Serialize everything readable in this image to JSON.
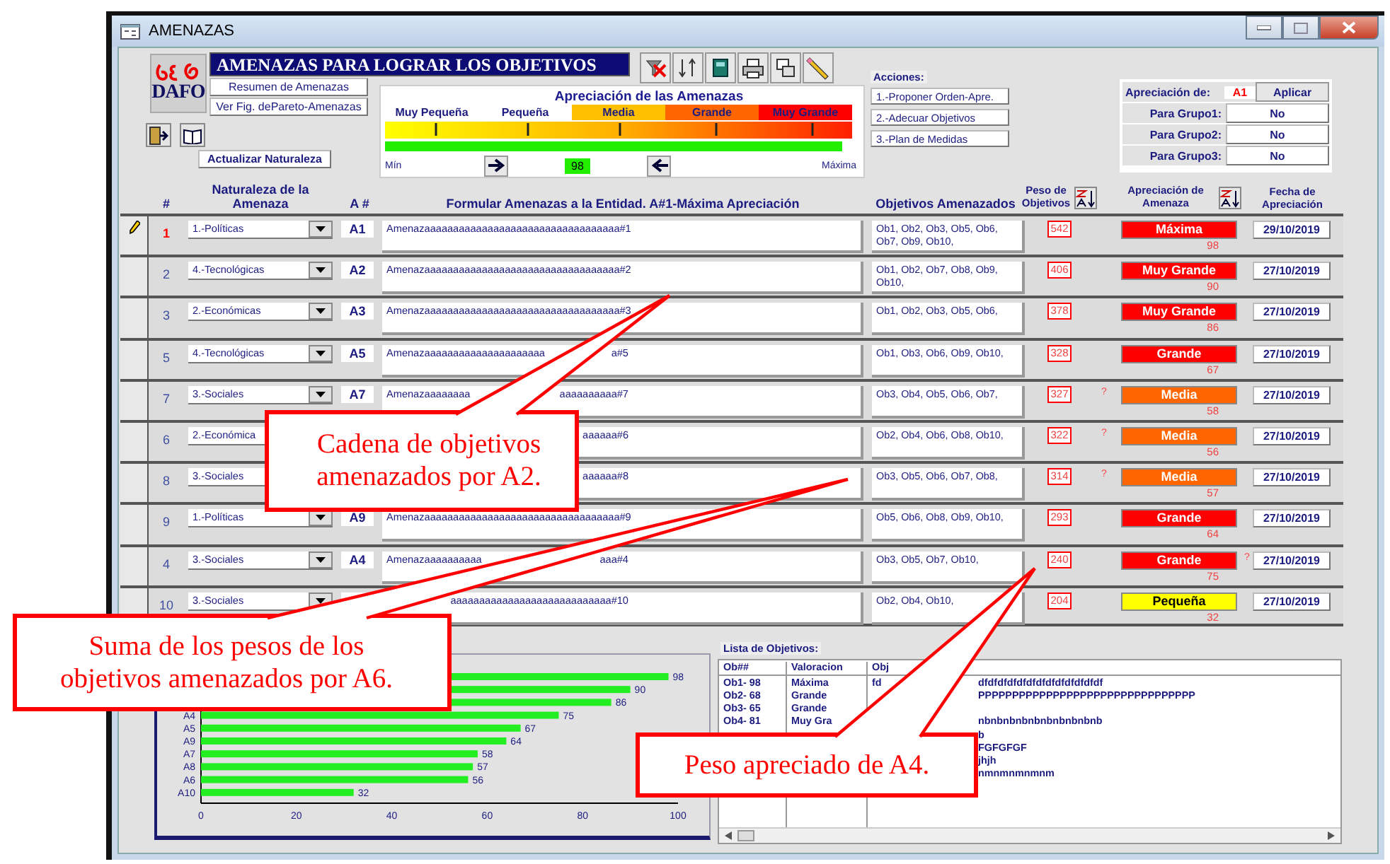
{
  "window": {
    "title": "AMENAZAS"
  },
  "logo": {
    "text": "DAFO"
  },
  "banner": "AMENAZAS PARA LOGRAR LOS OBJETIVOS",
  "left_buttons": [
    "Resumen de Amenazas",
    "Ver Fig. dePareto-Amenazas"
  ],
  "update_button": "Actualizar Naturaleza",
  "scale": {
    "title": "Apreciación de las Amenazas",
    "bands": [
      {
        "label": "Muy Pequeña"
      },
      {
        "label": "Pequeña"
      },
      {
        "label": "Media",
        "color": "#ffc000"
      },
      {
        "label": "Grande",
        "color": "#ff6600"
      },
      {
        "label": "Muy Grande",
        "color": "#ff0000"
      }
    ],
    "level": 0.98,
    "min_label": "Mín",
    "value": "98",
    "max_label": "Máxima"
  },
  "acciones": {
    "label": "Acciones:",
    "buttons": [
      "1.-Proponer Orden-Apre.",
      "2.-Adecuar Objetivos",
      "3.-Plan de Medidas"
    ]
  },
  "apreciacion": {
    "label": "Apreciación de:",
    "value": "A1",
    "apply": "Aplicar",
    "groups": [
      {
        "label": "Para Grupo1:",
        "value": "No"
      },
      {
        "label": "Para Grupo2:",
        "value": "No"
      },
      {
        "label": "Para Grupo3:",
        "value": "No"
      }
    ]
  },
  "table": {
    "columns": [
      "#",
      "Naturaleza de la Amenaza",
      "A #",
      "Formular Amenazas a la Entidad. A#1-Máxima Apreciación",
      "Objetivos Amenazados",
      "Peso de Objetivos",
      "Apreciación  de Amenaza",
      "Fecha de Apreciación"
    ],
    "rows": [
      {
        "selected": true,
        "num": "1",
        "nature": "1.-Políticas",
        "id": "A1",
        "text": "Amenazaaaaaaaaaaaaaaaaaaaaaaaaaaaaaaaaaa#1",
        "objectives": "Ob1, Ob2, Ob3, Ob5, Ob6, Ob7, Ob9, Ob10,",
        "weight": "542",
        "rating": "Máxima",
        "color": "#ff0000",
        "score": "98",
        "date": "29/10/2019"
      },
      {
        "selected": false,
        "num": "2",
        "nature": "4.-Tecnológicas",
        "id": "A2",
        "text": "Amenazaaaaaaaaaaaaaaaaaaaaaaaaaaaaaaaaaa#2",
        "objectives": "Ob1, Ob2, Ob7, Ob8, Ob9, Ob10,",
        "weight": "406",
        "rating": "Muy Grande",
        "color": "#ff0000",
        "score": "90",
        "date": "27/10/2019"
      },
      {
        "selected": false,
        "num": "3",
        "nature": "2.-Económicas",
        "id": "A3",
        "text": "Amenazaaaaaaaaaaaaaaaaaaaaaaaaaaaaaaaaaa#3",
        "objectives": "Ob1, Ob2, Ob3, Ob5, Ob6,",
        "weight": "378",
        "rating": "Muy Grande",
        "color": "#ff0000",
        "score": "86",
        "date": "27/10/2019"
      },
      {
        "selected": false,
        "num": "5",
        "nature": "4.-Tecnológicas",
        "id": "A5",
        "text": "Amenazaaaaaaaaaaaaaaaaaaaaa",
        "text_end": "a#5",
        "objectives": "Ob1, Ob3, Ob6, Ob9, Ob10,",
        "weight": "328",
        "rating": "Grande",
        "color": "#ff0000",
        "score": "67",
        "date": "27/10/2019"
      },
      {
        "selected": false,
        "num": "7",
        "nature": "3.-Sociales",
        "id": "A7",
        "text": "Amenazaaaaaaaa",
        "text_end": "aaaaaaaaaa#7",
        "objectives": "Ob3, Ob4, Ob5, Ob6, Ob7,",
        "weight": "327",
        "mark_before": "?",
        "rating": "Media",
        "color": "#ff6600",
        "score": "58",
        "date": "27/10/2019"
      },
      {
        "selected": false,
        "num": "6",
        "nature": "2.-Económica",
        "text_end": "aaaaaa#6",
        "objectives": "Ob2, Ob4, Ob6, Ob8, Ob10,",
        "weight": "322",
        "mark_before": "?",
        "rating": "Media",
        "color": "#ff6600",
        "score": "56",
        "date": "27/10/2019"
      },
      {
        "selected": false,
        "num": "8",
        "nature": "3.-Sociales",
        "text_end": "aaaaaa#8",
        "objectives": "Ob3, Ob5, Ob6, Ob7, Ob8,",
        "weight": "314",
        "mark_before": "?",
        "rating": "Media",
        "color": "#ff6600",
        "score": "57",
        "date": "27/10/2019"
      },
      {
        "selected": false,
        "num": "9",
        "nature": "1.-Políticas",
        "id": "A9",
        "text": "Amenazaaaaaaaaaaaaaaaaaaaaaaaaaaaaaaaaaa#9",
        "objectives": "Ob5, Ob6, Ob8, Ob9, Ob10,",
        "weight": "293",
        "rating": "Grande",
        "color": "#ff0000",
        "score": "64",
        "date": "27/10/2019"
      },
      {
        "selected": false,
        "num": "4",
        "nature": "3.-Sociales",
        "id": "A4",
        "text": "Amenazaaaaaaaaaa",
        "text_end": "aaa#4",
        "objectives": "Ob3, Ob5, Ob7, Ob10,",
        "weight": "240",
        "rating": "Grande",
        "color": "#ff0000",
        "score": "75",
        "mark_after": "?",
        "date": "27/10/2019"
      },
      {
        "selected": false,
        "num": "10",
        "nature": "3.-Sociales",
        "text_end": "aaaaaaaaaaaaaaaaaaaaaaaaaaaa#10",
        "objectives": "Ob2, Ob4, Ob10,",
        "weight": "204",
        "rating": "Pequeña",
        "color": "#ffff00",
        "score": "32",
        "date": "27/10/2019"
      }
    ]
  },
  "chart_panel": {
    "chart_data": {
      "type": "bar",
      "orientation": "horizontal",
      "categories": [
        null,
        null,
        null,
        "A4",
        "A5",
        "A9",
        "A7",
        "A8",
        "A6",
        "A10"
      ],
      "values": [
        98,
        90,
        86,
        75,
        67,
        64,
        58,
        57,
        56,
        32
      ],
      "xlim": [
        0,
        100
      ],
      "xticks": [
        0,
        20,
        40,
        60,
        80,
        100
      ],
      "data_labels": true
    }
  },
  "objectives_list": {
    "title": "Lista de Objetivos:",
    "columns": [
      "Ob##",
      "Valoracion",
      "Obj"
    ],
    "rows": [
      {
        "ob": "Ob1-  98",
        "rating": "Máxima",
        "obj": "fd",
        "obj_end": "dfdfdfdfdfdfdfdfdfdfdfdfdf"
      },
      {
        "ob": "Ob2-  68",
        "rating": "Grande",
        "obj_end": "PPPPPPPPPPPPPPPPPPPPPPPPPPPPPPPP"
      },
      {
        "ob": "Ob3-  65",
        "rating": "Grande"
      },
      {
        "ob": "Ob4-  81",
        "rating": "Muy Gra",
        "obj_end": "nbnbnbnbnbnbnbnbnbnb"
      },
      {
        "obj_end": "b"
      },
      {
        "obj_end": "FGFGFGF"
      },
      {
        "obj_end": "jhjh"
      },
      {
        "obj_end": "nmnmnmnmnm"
      }
    ]
  },
  "callouts": [
    {
      "text": "Cadena de objetivos amenazados por A2."
    },
    {
      "text": "Suma de los pesos de los objetivos amenazados por A6."
    },
    {
      "text": "Peso apreciado de A4."
    }
  ]
}
